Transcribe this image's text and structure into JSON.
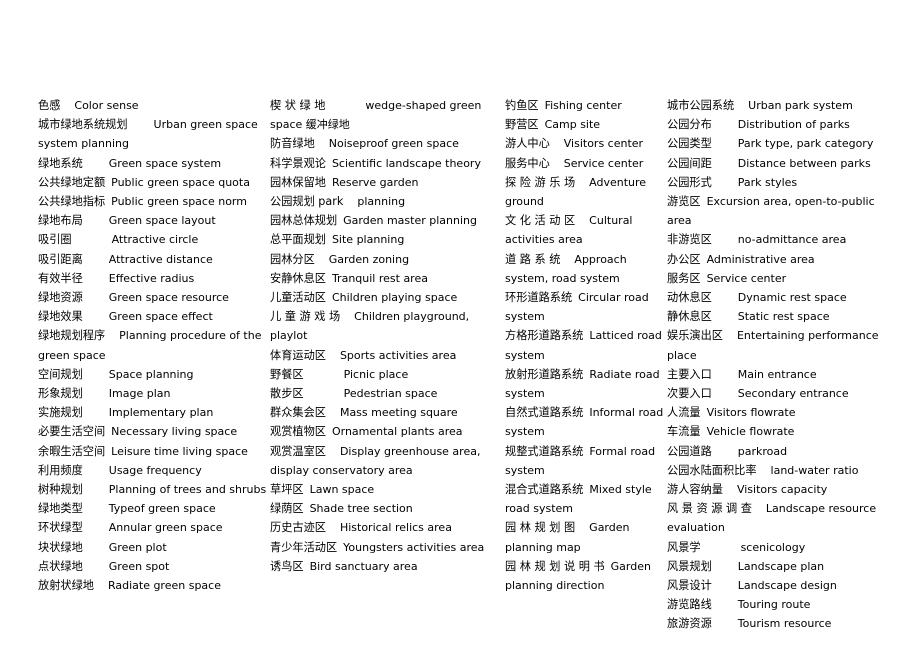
{
  "document": {
    "type": "glossary",
    "title": "Chinese-English Landscape and Urban Green Space Planning Glossary",
    "background_color": "#ffffff",
    "text_color": "#000000",
    "column_count": 4
  },
  "columns": [
    {
      "name": "column-1",
      "entries": [
        {
          "zh": "色感",
          "en": "Color sense",
          "gap": "md",
          "justify": false
        },
        {
          "zh": "城市绿地系统规划",
          "en": "Urban  green  space system planning",
          "gap": "lg",
          "justify": false
        },
        {
          "zh": "绿地系统",
          "en": "Green space system",
          "gap": "lg",
          "justify": false
        },
        {
          "zh": "公共绿地定额",
          "en": "Public green space quota",
          "gap": "sm",
          "justify": false
        },
        {
          "zh": "公共绿地指标",
          "en": "Public green space norm",
          "gap": "sm",
          "justify": false
        },
        {
          "zh": "绿地布局",
          "en": "Green space layout",
          "gap": "lg",
          "justify": false
        },
        {
          "zh": "吸引圈",
          "en": "Attractive circle",
          "gap": "xl",
          "justify": false
        },
        {
          "zh": "吸引距离",
          "en": "Attractive distance",
          "gap": "lg",
          "justify": false
        },
        {
          "zh": "有效半径",
          "en": "Effective radius",
          "gap": "lg",
          "justify": false
        },
        {
          "zh": "绿地资源",
          "en": "Green space resource",
          "gap": "lg",
          "justify": false
        },
        {
          "zh": "绿地效果",
          "en": "Green space effect",
          "gap": "lg",
          "justify": false
        },
        {
          "zh": "绿地规划程序",
          "en": "Planning  procedure  of  the green space",
          "gap": "md",
          "justify": false
        },
        {
          "zh": "空间规划",
          "en": "Space planning",
          "gap": "lg",
          "justify": false
        },
        {
          "zh": "形象规划",
          "en": "Image plan",
          "gap": "lg",
          "justify": false
        },
        {
          "zh": "实施规划",
          "en": "Implementary plan",
          "gap": "lg",
          "justify": false
        },
        {
          "zh": "必要生活空间",
          "en": "Necessary living space",
          "gap": "sm",
          "justify": false
        },
        {
          "zh": "余暇生活空间",
          "en": "Leisure time living space",
          "gap": "sm",
          "justify": false
        },
        {
          "zh": "利用频度",
          "en": "Usage frequency",
          "gap": "lg",
          "justify": false
        },
        {
          "zh": "树种规划",
          "en": "Planning of trees and shrubs",
          "gap": "lg",
          "justify": false
        },
        {
          "zh": "绿地类型",
          "en": "Typeof green space",
          "gap": "lg",
          "justify": false
        },
        {
          "zh": "环状绿型",
          "en": "Annular green space",
          "gap": "lg",
          "justify": false
        },
        {
          "zh": "块状绿地",
          "en": "Green plot",
          "gap": "lg",
          "justify": false
        },
        {
          "zh": "点状绿地",
          "en": "Green spot",
          "gap": "lg",
          "justify": false
        },
        {
          "zh": "放射状绿地",
          "en": "Radiate green space",
          "gap": "md",
          "justify": false
        }
      ]
    },
    {
      "name": "column-2",
      "entries": [
        {
          "zh": "楔 状 绿 地",
          "en": "wedge-shaped  green space 缓冲绿地",
          "gap": "xl",
          "justify": false
        },
        {
          "zh": "",
          "en": "",
          "gap": "sm",
          "justify": false,
          "skip": true
        },
        {
          "zh": "防音绿地",
          "en": "Noiseproof green space",
          "gap": "md",
          "justify": false
        },
        {
          "zh": "科学景观论",
          "en": "Scientific landscape theory",
          "gap": "sm",
          "justify": false
        },
        {
          "zh": "园林保留地",
          "en": "Reserve garden",
          "gap": "sm",
          "justify": false
        },
        {
          "zh": "公园规划 park",
          "en": "planning",
          "gap": "md",
          "justify": false
        },
        {
          "zh": "园林总体规划",
          "en": "Garden master planning",
          "gap": "sm",
          "justify": false
        },
        {
          "zh": "总平面规划",
          "en": "Site planning",
          "gap": "sm",
          "justify": false
        },
        {
          "zh": "园林分区",
          "en": "Garden zoning",
          "gap": "md",
          "justify": false
        },
        {
          "zh": "安静休息区",
          "en": "Tranquil rest area",
          "gap": "sm",
          "justify": false
        },
        {
          "zh": "儿童活动区",
          "en": "Children playing space",
          "gap": "sm",
          "justify": false
        },
        {
          "zh": "儿 童 游 戏 场",
          "en": "Children  playground, playlot",
          "gap": "md",
          "justify": false
        },
        {
          "zh": "体育运动区",
          "en": "Sports activities area",
          "gap": "md",
          "justify": false
        },
        {
          "zh": "野餐区",
          "en": "Picnic place",
          "gap": "xl",
          "justify": false
        },
        {
          "zh": "散步区",
          "en": "Pedestrian space",
          "gap": "xl",
          "justify": false
        },
        {
          "zh": "群众集会区",
          "en": "Mass meeting square",
          "gap": "md",
          "justify": false
        },
        {
          "zh": "观赏植物区",
          "en": "Ornamental plants area",
          "gap": "sm",
          "justify": false
        },
        {
          "zh": "观赏温室区",
          "en": "Display greenhouse area, display                    conservatory area",
          "gap": "md",
          "justify": false
        },
        {
          "zh": "草坪区",
          "en": "Lawn space",
          "gap": "sm",
          "justify": false
        },
        {
          "zh": "绿荫区",
          "en": "Shade tree section",
          "gap": "sm",
          "justify": false
        },
        {
          "zh": "历史古迹区",
          "en": "Historical relics area",
          "gap": "md",
          "justify": false
        },
        {
          "zh": "青少年活动区",
          "en": "Youngsters activities area",
          "gap": "sm",
          "justify": false
        },
        {
          "zh": "诱鸟区",
          "en": "Bird sanctuary area",
          "gap": "sm",
          "justify": false
        }
      ]
    },
    {
      "name": "column-3",
      "entries": [
        {
          "zh": "钓鱼区",
          "en": "Fishing center",
          "gap": "sm",
          "justify": false
        },
        {
          "zh": "野营区",
          "en": "Camp site",
          "gap": "sm",
          "justify": false
        },
        {
          "zh": "游人中心",
          "en": "Visitors center",
          "gap": "md",
          "justify": false
        },
        {
          "zh": "服务中心",
          "en": "Service center",
          "gap": "md",
          "justify": false
        },
        {
          "zh": "探 险 游 乐 场",
          "en": "Adventure ground",
          "gap": "md",
          "justify": false
        },
        {
          "zh": "文 化 活 动 区",
          "en": "Cultural activities area",
          "gap": "md",
          "justify": false
        },
        {
          "zh": "道 路 系 统",
          "en": "Approach system, road system",
          "gap": "md",
          "justify": false
        },
        {
          "zh": "环形道路系统",
          "en": "Circular  road system",
          "gap": "sm",
          "justify": false
        },
        {
          "zh": "方格形道路系统",
          "en": "Latticed road system",
          "gap": "sm",
          "justify": false
        },
        {
          "zh": "放射形道路系统",
          "en": "Radiate road system",
          "gap": "sm",
          "justify": false
        },
        {
          "zh": "自然式道路系统",
          "en": "Informal road system",
          "gap": "sm",
          "justify": false
        },
        {
          "zh": "规整式道路系统",
          "en": "Formal road system",
          "gap": "sm",
          "justify": false
        },
        {
          "zh": "混合式道路系统",
          "en": "Mixed style road system",
          "gap": "sm",
          "justify": false
        },
        {
          "zh": "园 林 规 划 图",
          "en": "Garden planning map",
          "gap": "md",
          "justify": false
        },
        {
          "zh": "园 林 规 划 说 明 书",
          "en": "Garden planning direction",
          "gap": "sm",
          "justify": false
        }
      ]
    },
    {
      "name": "column-4",
      "entries": [
        {
          "zh": "城市公园系统",
          "en": "Urban park system",
          "gap": "md",
          "justify": false
        },
        {
          "zh": "公园分布",
          "en": "Distribution of parks",
          "gap": "lg",
          "justify": false
        },
        {
          "zh": "公园类型",
          "en": "Park type, park category",
          "gap": "lg",
          "justify": false
        },
        {
          "zh": "公园间距",
          "en": "Distance between parks",
          "gap": "lg",
          "justify": false
        },
        {
          "zh": "公园形式",
          "en": "Park styles",
          "gap": "lg",
          "justify": false
        },
        {
          "zh": "游览区",
          "en": "Excursion area, open-to-public area",
          "gap": "sm",
          "justify": false
        },
        {
          "zh": "非游览区",
          "en": "no-admittance area",
          "gap": "lg",
          "justify": false
        },
        {
          "zh": "办公区",
          "en": "Administrative area",
          "gap": "sm",
          "justify": false
        },
        {
          "zh": "服务区",
          "en": "Service center",
          "gap": "sm",
          "justify": false
        },
        {
          "zh": "动休息区",
          "en": "Dynamic rest space",
          "gap": "lg",
          "justify": false
        },
        {
          "zh": "静休息区",
          "en": "Static rest space",
          "gap": "lg",
          "justify": false
        },
        {
          "zh": "娱乐演出区",
          "en": "Entertaining performance place",
          "gap": "md",
          "justify": false
        },
        {
          "zh": "主要入口",
          "en": "Main entrance",
          "gap": "lg",
          "justify": false
        },
        {
          "zh": "次要入口",
          "en": "Secondary entrance",
          "gap": "lg",
          "justify": false
        },
        {
          "zh": "人流量",
          "en": "Visitors flowrate",
          "gap": "sm",
          "justify": false
        },
        {
          "zh": "车流量",
          "en": "Vehicle flowrate",
          "gap": "sm",
          "justify": false
        },
        {
          "zh": "公园道路",
          "en": "parkroad",
          "gap": "lg",
          "justify": false
        },
        {
          "zh": "公园水陆面积比率",
          "en": "land-water ratio",
          "gap": "md",
          "justify": false
        },
        {
          "zh": "游人容纳量",
          "en": "Visitors capacity",
          "gap": "md",
          "justify": false
        },
        {
          "zh": "风 景 资 源 调 查",
          "en": "Landscape  resource evaluation",
          "gap": "md",
          "justify": false
        },
        {
          "zh": "风景学",
          "en": "scenicology",
          "gap": "xl",
          "justify": false
        },
        {
          "zh": "风景规划",
          "en": "Landscape plan",
          "gap": "lg",
          "justify": false
        },
        {
          "zh": "风景设计",
          "en": "Landscape design",
          "gap": "lg",
          "justify": false
        },
        {
          "zh": "游览路线",
          "en": "Touring route",
          "gap": "lg",
          "justify": false
        },
        {
          "zh": "旅游资源",
          "en": "Tourism resource",
          "gap": "lg",
          "justify": false
        }
      ]
    }
  ]
}
